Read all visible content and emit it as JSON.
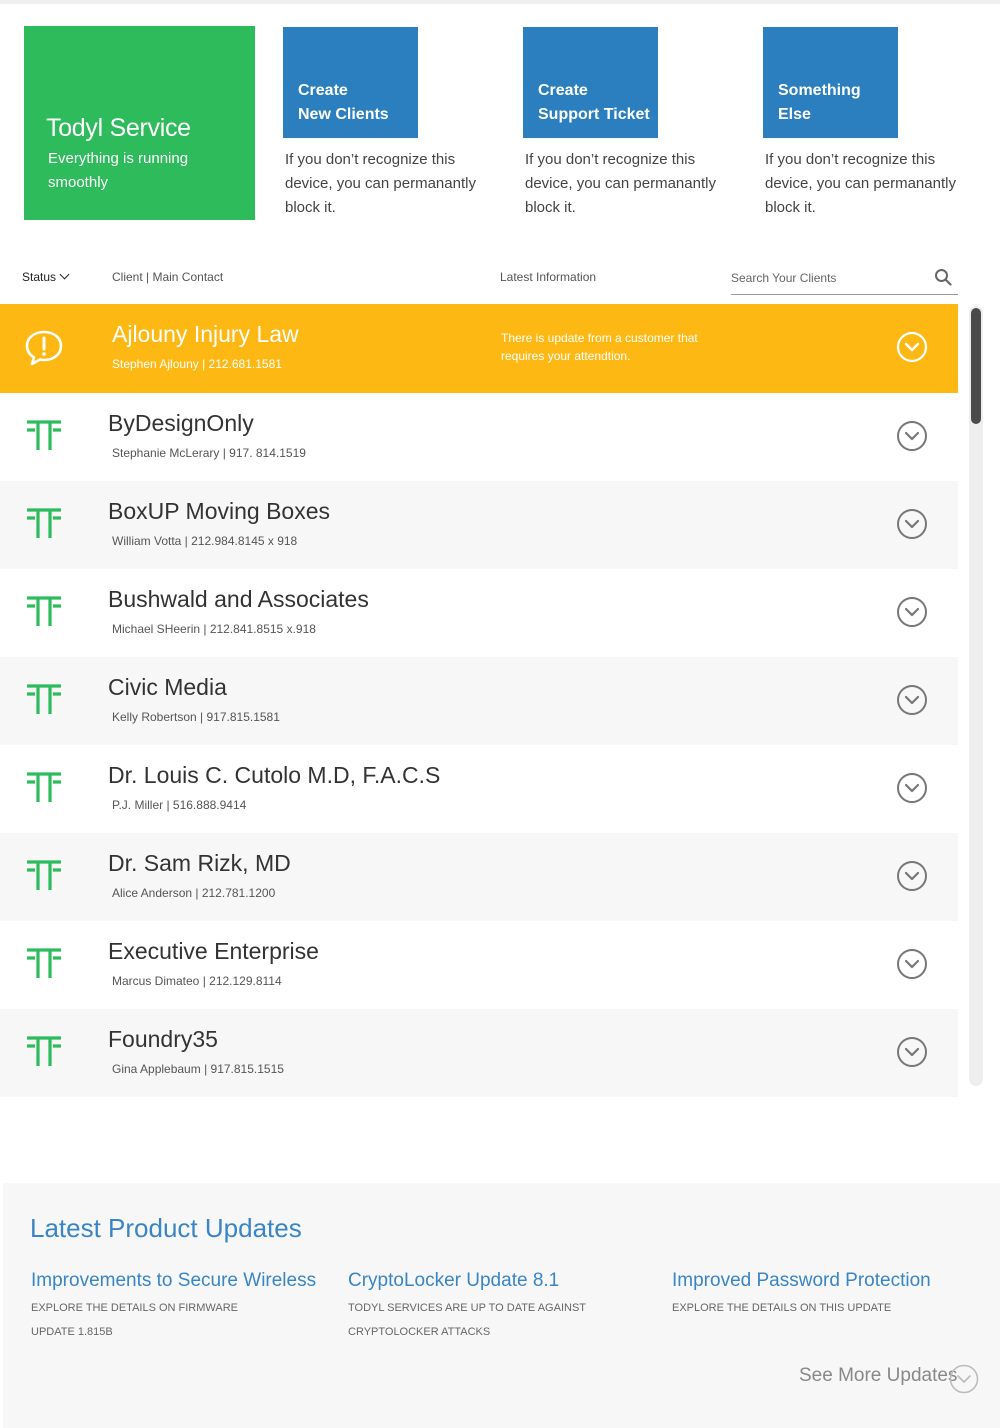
{
  "status_tile": {
    "title": "Todyl Service",
    "subtitle": "Everything is running smoothly"
  },
  "actions": [
    {
      "line1": "Create",
      "line2": "New Clients",
      "desc": "If  you don’t recognize this device, you can permanantly block it."
    },
    {
      "line1": "Create",
      "line2": "Support Ticket",
      "desc": "If  you don’t recognize this device, you can permanantly block it."
    },
    {
      "line1": "Something",
      "line2": "Else",
      "desc": "If  you don’t recognize this device, you can permanantly block it."
    }
  ],
  "list_header": {
    "status": "Status",
    "client": "Client | Main Contact",
    "latest": "Latest Information",
    "search_placeholder": "Search Your Clients"
  },
  "clients": [
    {
      "name": "Ajlouny Injury Law",
      "contact": "Stephen Ajlouny | 212.681.1581",
      "info": "There is update from a customer that requires your attendtion.",
      "status": "alert"
    },
    {
      "name": "ByDesignOnly",
      "contact": "Stephanie McLerary | 917. 814.1519"
    },
    {
      "name": "BoxUP Moving Boxes",
      "contact": "William Votta | 212.984.8145 x 918"
    },
    {
      "name": "Bushwald and Associates",
      "contact": "Michael SHeerin | 212.841.8515 x.918"
    },
    {
      "name": "Civic Media",
      "contact": "Kelly Robertson | 917.815.1581"
    },
    {
      "name": "Dr. Louis C. Cutolo M.D, F.A.C.S",
      "contact": "P.J. Miller | 516.888.9414"
    },
    {
      "name": "Dr. Sam Rizk, MD",
      "contact": "Alice Anderson | 212.781.1200"
    },
    {
      "name": "Executive Enterprise",
      "contact": "Marcus Dimateo | 212.129.8114"
    },
    {
      "name": "Foundry35",
      "contact": "Gina Applebaum | 917.815.1515"
    }
  ],
  "updates": {
    "heading": "Latest Product Updates",
    "items": [
      {
        "title": "Improvements to Secure Wireless",
        "desc": "Explore the details on firmware update 1.815b"
      },
      {
        "title": "CryptoLocker Update 8.1",
        "desc": "Todyl services are up to date against cryptolocker attacks"
      },
      {
        "title": "Improved Password Protection",
        "desc": "Explore the details on this update"
      }
    ],
    "more": "See More Updates"
  },
  "colors": {
    "green": "#2dbb5c",
    "blue": "#2b7fbf",
    "alert": "#fdb813",
    "link": "#3a85c6"
  },
  "icons": {
    "alert": "alert-bubble-icon",
    "client": "todyl-logo-icon",
    "expand": "chevron-down-circle-icon",
    "search": "search-icon"
  }
}
